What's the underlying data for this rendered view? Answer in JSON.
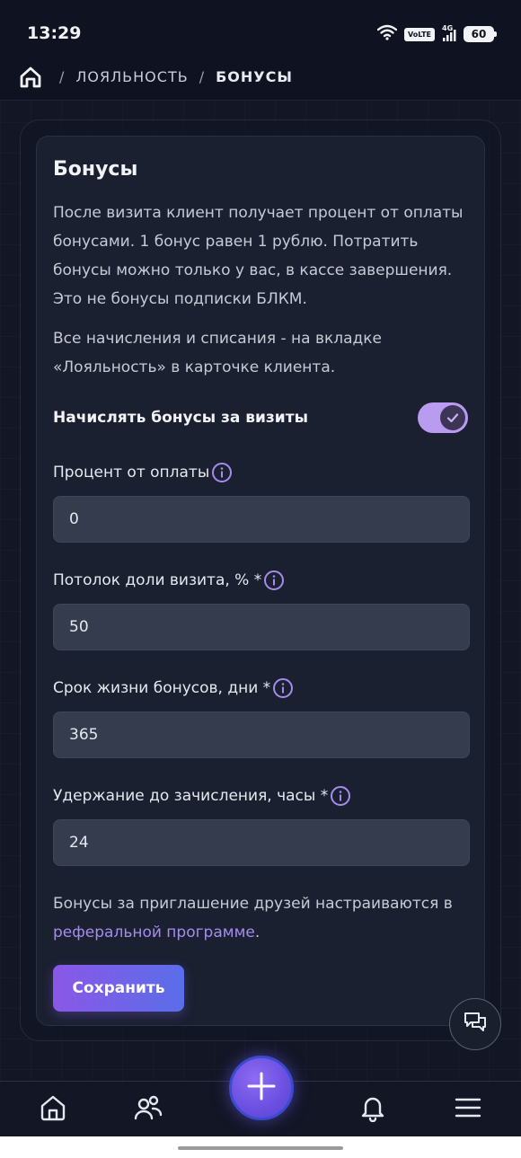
{
  "status_bar": {
    "time": "13:29",
    "volte": "VoLTE",
    "network": "4G",
    "battery": "60"
  },
  "breadcrumb": {
    "separator": "/",
    "items": [
      "ЛОЯЛЬНОСТЬ",
      "БОНУСЫ"
    ]
  },
  "card": {
    "title": "Бонусы",
    "description": "После визита клиент получает процент от оплаты бонусами. 1 бонус равен 1 рублю. Потратить бонусы можно только у вас, в кассе завершения. Это не бонусы подписки БЛКМ.",
    "description2": "Все начисления и списания - на вкладке «Лояльность» в карточке клиента.",
    "toggle_label": "Начислять бонусы за визиты",
    "toggle_on": true,
    "fields": [
      {
        "label": "Процент от оплаты",
        "value": "0"
      },
      {
        "label": "Потолок доли визита, % *",
        "value": "50"
      },
      {
        "label": "Срок жизни бонусов, дни *",
        "value": "365"
      },
      {
        "label": "Удержание до зачисления, часы *",
        "value": "24"
      }
    ],
    "note_prefix": "Бонусы за приглашение друзей настраиваются в ",
    "note_link": "реферальной программе",
    "note_suffix": ".",
    "save_label": "Сохранить"
  },
  "colors": {
    "accent": "#a58bee",
    "toggle_track": "#b99cf0",
    "button_gradient_start": "#8a57e6",
    "button_gradient_end": "#5a6ee9",
    "background": "#121625",
    "card": "#1b2030"
  },
  "bottom_nav": [
    "home-icon",
    "clients-icon",
    "plus-icon",
    "bell-icon",
    "menu-icon"
  ]
}
